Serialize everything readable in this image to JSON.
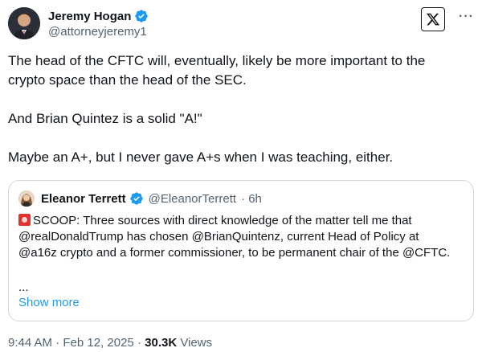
{
  "author": {
    "name": "Jeremy Hogan",
    "handle": "@attorneyjeremy1"
  },
  "tweet": {
    "paragraphs": [
      "The head of the CFTC will, eventually, likely be more important to the crypto space than the head of the SEC.",
      "And Brian Quintez is a solid \"A!\"",
      "Maybe an A+, but I never gave A+s when I was teaching, either."
    ]
  },
  "quote": {
    "name": "Eleanor Terrett",
    "handle": "@EleanorTerrett",
    "time": "· 6h",
    "text": "SCOOP: Three sources with direct knowledge of the matter tell me that @realDonaldTrump has chosen @BrianQuintenz, current Head of Policy at @a16z crypto and a former commissioner, to be permanent chair of the @CFTC.",
    "ellipsis": "...",
    "show_more": "Show more"
  },
  "footer": {
    "time": "9:44 AM",
    "sep1": " · ",
    "date": "Feb 12, 2025",
    "sep2": " · ",
    "views_count": "30.3K",
    "views_label": " Views"
  },
  "icons": {
    "verified": "verified-badge-icon",
    "logo": "x-logo-icon",
    "more": "more-options-icon",
    "siren": "siren-emoji-icon"
  },
  "colors": {
    "accent": "#1d9bf0",
    "secondary_text": "#536471",
    "border": "#cfd9de"
  }
}
